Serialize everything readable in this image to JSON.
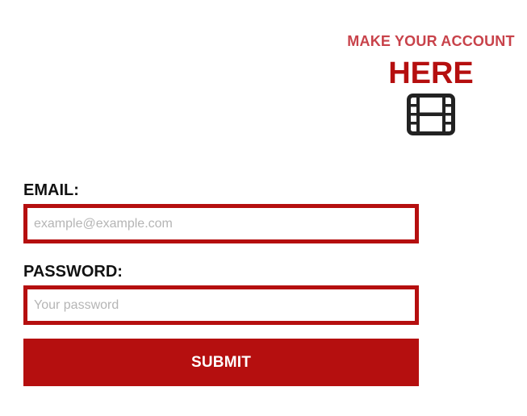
{
  "header": {
    "subtitle": "MAKE YOUR ACCOUNT",
    "title": "HERE",
    "icon": "film-icon"
  },
  "form": {
    "email_label": "EMAIL:",
    "email_placeholder": "example@example.com",
    "email_value": "",
    "password_label": "PASSWORD:",
    "password_placeholder": "Your password",
    "password_value": "",
    "submit_label": "SUBMIT"
  },
  "colors": {
    "accent": "#b50f0f",
    "subtitle": "#c8424a",
    "icon": "#222222",
    "placeholder": "#b5b5b5",
    "label": "#111111"
  }
}
